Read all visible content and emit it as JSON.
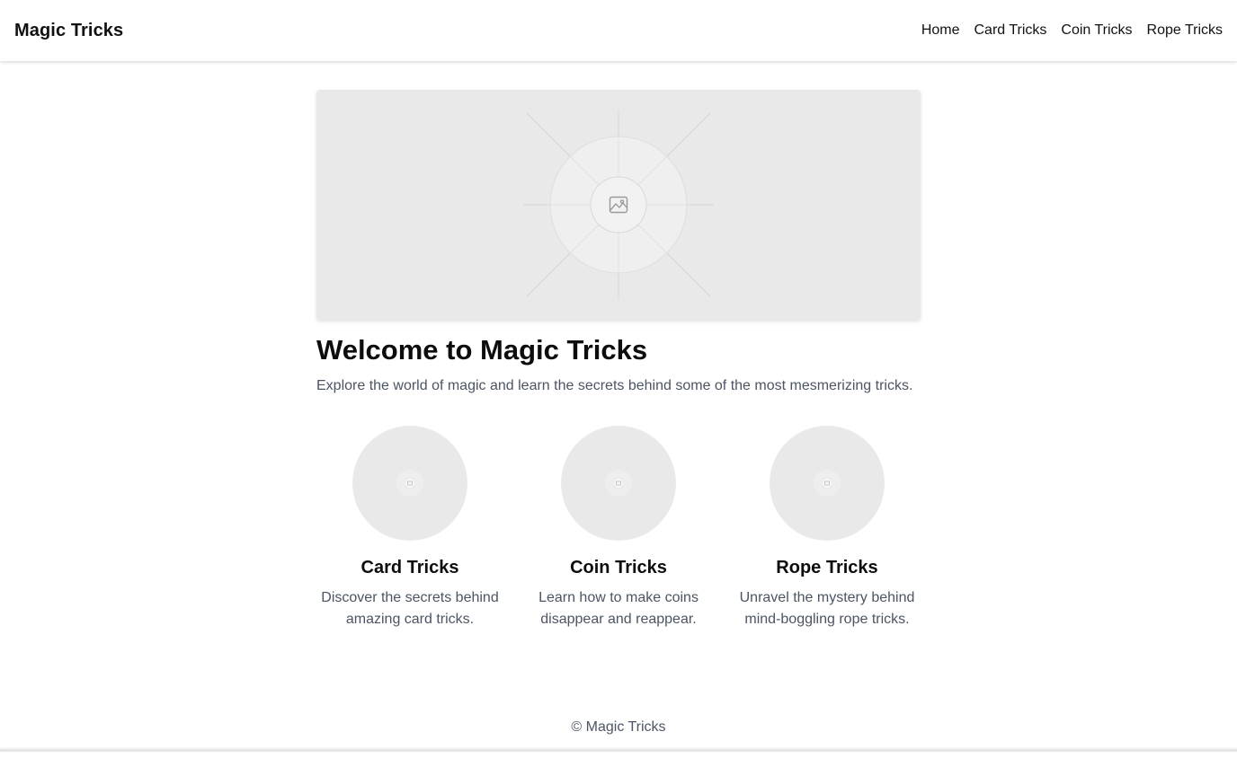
{
  "header": {
    "brand": "Magic Tricks",
    "nav": [
      "Home",
      "Card Tricks",
      "Coin Tricks",
      "Rope Tricks"
    ]
  },
  "hero": {
    "image_icon": "image-placeholder-icon",
    "title": "Welcome to Magic Tricks",
    "subtitle": "Explore the world of magic and learn the secrets behind some of the most mesmerizing tricks."
  },
  "cards": [
    {
      "title": "Card Tricks",
      "description": "Discover the secrets behind amazing card tricks."
    },
    {
      "title": "Coin Tricks",
      "description": "Learn how to make coins disappear and reappear."
    },
    {
      "title": "Rope Tricks",
      "description": "Unravel the mystery behind mind-boggling rope tricks."
    }
  ],
  "footer": {
    "text": "© Magic Tricks"
  },
  "colors": {
    "placeholder_bg": "#e9e9e9",
    "muted_text": "#4b5563",
    "heading_text": "#0d0d0d"
  }
}
